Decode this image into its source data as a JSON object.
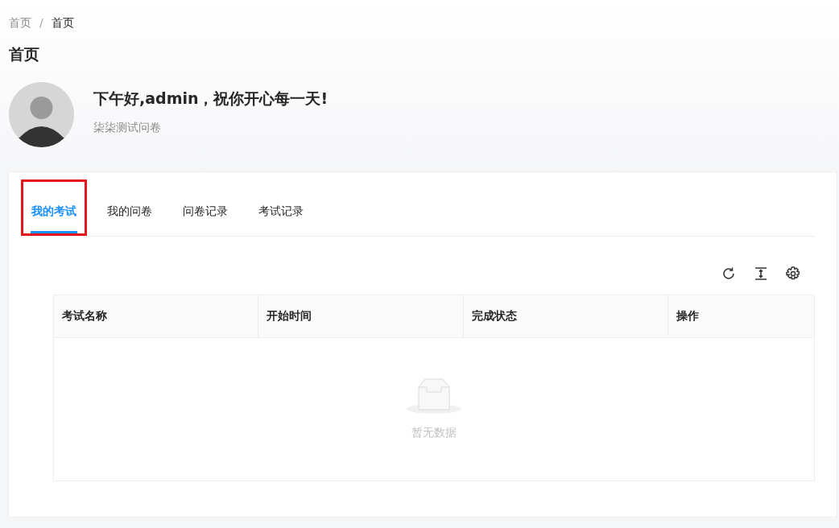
{
  "breadcrumb": [
    {
      "label": "首页",
      "current": false
    },
    {
      "label": "/",
      "kind": "separator"
    },
    {
      "label": "首页",
      "current": true
    }
  ],
  "page_title": "首页",
  "greeting": {
    "title": "下午好,admin，祝你开心每一天!",
    "subtitle": "柒柒测试问卷"
  },
  "tabs": [
    {
      "label": "我的考试",
      "selected": true,
      "highlighted": true
    },
    {
      "label": "我的问卷",
      "selected": false,
      "highlighted": false
    },
    {
      "label": "问卷记录",
      "selected": false,
      "highlighted": false
    },
    {
      "label": "考试记录",
      "selected": false,
      "highlighted": false
    }
  ],
  "table": {
    "columns": [
      "考试名称",
      "开始时间",
      "完成状态",
      "操作"
    ],
    "empty_text": "暂无数据"
  }
}
